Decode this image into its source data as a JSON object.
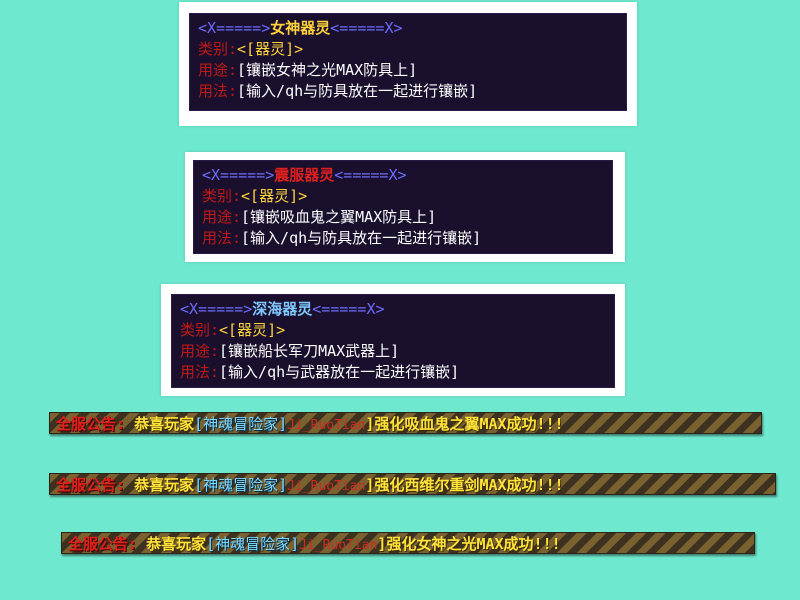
{
  "tooltips": [
    {
      "arrow_left": "<X=====>",
      "name": "女神器灵",
      "arrow_right": "<=====X>",
      "name_color": "#ffd13a",
      "rows": [
        {
          "label": "类别:",
          "value": "<[器灵]>",
          "kind": "category"
        },
        {
          "label": "用途:",
          "value": "[镶嵌女神之光MAX防具上]",
          "kind": "text"
        },
        {
          "label": "用法:",
          "value": "[输入/qh与防具放在一起进行镶嵌]",
          "kind": "text"
        }
      ]
    },
    {
      "arrow_left": "<X=====>",
      "name": "震服器灵",
      "arrow_right": "<=====X>",
      "name_color": "#e02020",
      "rows": [
        {
          "label": "类别:",
          "value": "<[器灵]>",
          "kind": "category"
        },
        {
          "label": "用途:",
          "value": "[镶嵌吸血鬼之翼MAX防具上]",
          "kind": "text"
        },
        {
          "label": "用法:",
          "value": "[输入/qh与防具放在一起进行镶嵌]",
          "kind": "text"
        }
      ]
    },
    {
      "arrow_left": "<X=====>",
      "name": "深海器灵",
      "arrow_right": "<=====X>",
      "name_color": "#7fc8ff",
      "rows": [
        {
          "label": "类别:",
          "value": "<[器灵]>",
          "kind": "category"
        },
        {
          "label": "用途:",
          "value": "[镶嵌船长军刀MAX武器上]",
          "kind": "text"
        },
        {
          "label": "用法:",
          "value": "[输入/qh与武器放在一起进行镶嵌]",
          "kind": "text"
        }
      ]
    }
  ],
  "announcements": [
    {
      "prefix": "全服公告:",
      "congrats": "恭喜玩家",
      "guild": "[神魂冒险家]",
      "player": "Ji_RuoTian",
      "enhance": "]强化吸血鬼之翼MAX成功!!!"
    },
    {
      "prefix": "全服公告:",
      "congrats": "恭喜玩家",
      "guild": "[神魂冒险家]",
      "player": "Ji_RuoTian",
      "enhance": "]强化西维尔重剑MAX成功!!!"
    },
    {
      "prefix": "全服公告:",
      "congrats": "恭喜玩家",
      "guild": "[神魂冒险家]",
      "player": "Ji_RuoTian",
      "enhance": "]强化女神之光MAX成功!!!"
    }
  ]
}
